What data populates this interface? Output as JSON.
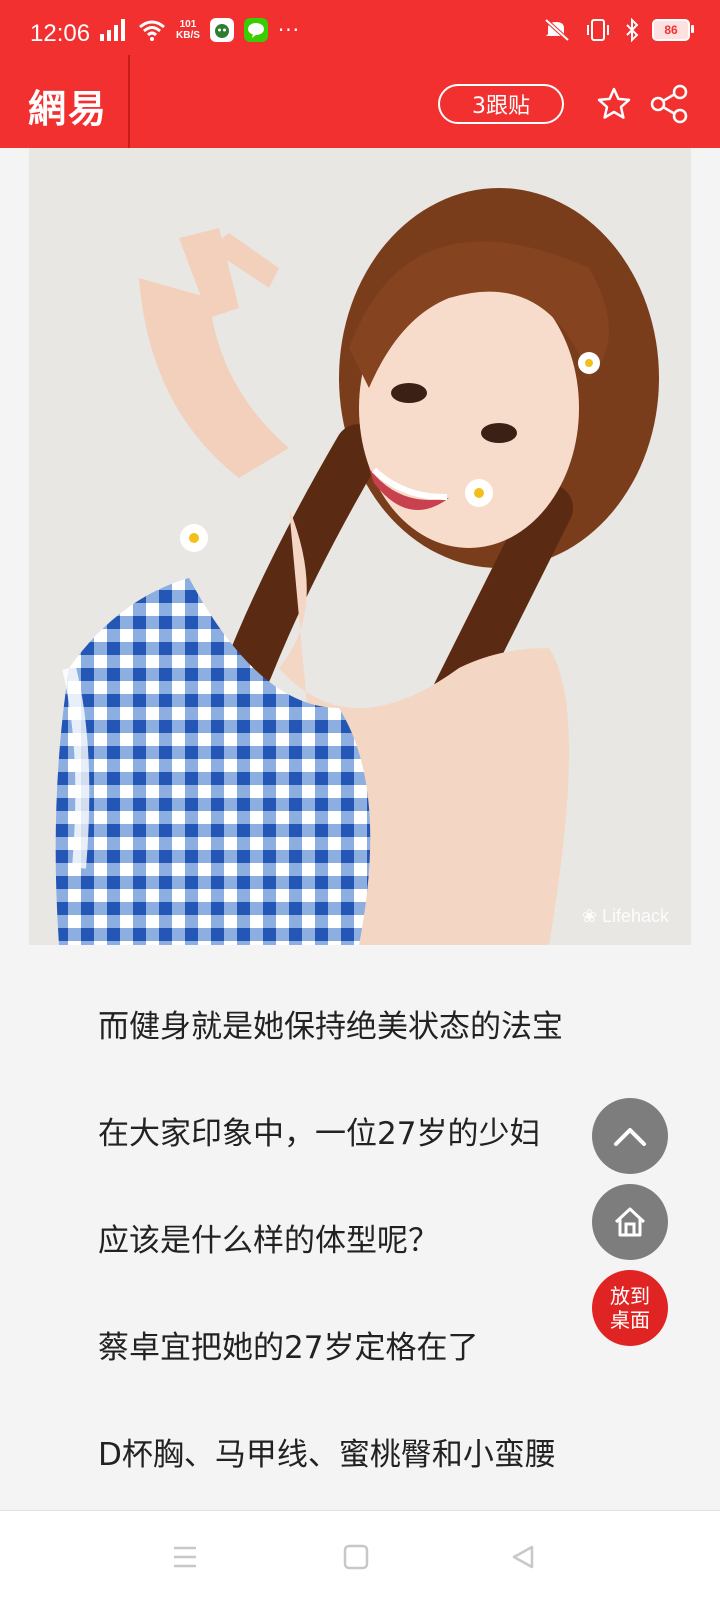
{
  "status_bar": {
    "time": "12:06",
    "net_speed_value": "101",
    "net_speed_unit": "KB/S",
    "battery": "86",
    "more": "···"
  },
  "header": {
    "logo": "網易",
    "comments_label": "3跟贴"
  },
  "image": {
    "watermark": "Lifehack"
  },
  "article": {
    "paragraphs": [
      "而健身就是她保持绝美状态的法宝",
      "在大家印象中，一位27岁的少妇",
      "应该是什么样的体型呢？",
      "蔡卓宜把她的27岁定格在了",
      "D杯胸、马甲线、蜜桃臀和小蛮腰"
    ]
  },
  "floating": {
    "desktop_label_1": "放到",
    "desktop_label_2": "桌面"
  },
  "colors": {
    "brand_red": "#f23030",
    "fab_gray": "#7d7d7d",
    "fab_red": "#e02424"
  }
}
